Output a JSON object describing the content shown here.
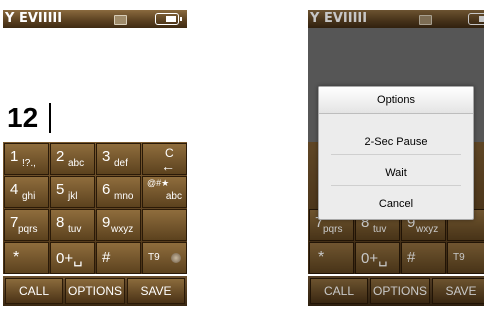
{
  "status": {
    "signal": "Y EV",
    "bars": "IIIII"
  },
  "display": {
    "number": "12"
  },
  "keys": [
    {
      "digit": "1",
      "sub": "!?.,"
    },
    {
      "digit": "2",
      "sub": "abc"
    },
    {
      "digit": "3",
      "sub": "def"
    },
    {
      "digit": "C",
      "sub": "←"
    },
    {
      "digit": "4",
      "sub": "ghi"
    },
    {
      "digit": "5",
      "sub": "jkl"
    },
    {
      "digit": "6",
      "sub": "mno"
    },
    {
      "digit": "@#★",
      "sub": "abc"
    },
    {
      "digit": "7",
      "sub": "pqrs"
    },
    {
      "digit": "8",
      "sub": "tuv"
    },
    {
      "digit": "9",
      "sub": "wxyz"
    },
    {
      "digit": "",
      "sub": ""
    },
    {
      "digit": "*",
      "sub": ""
    },
    {
      "digit": "0+␣",
      "sub": ""
    },
    {
      "digit": "#",
      "sub": ""
    },
    {
      "digit": "T9",
      "sub": ""
    }
  ],
  "softkeys": {
    "call": "CALL",
    "options": "OPTIONS",
    "save": "SAVE"
  },
  "options_menu": {
    "title": "Options",
    "items": [
      "2-Sec Pause",
      "Wait",
      "Cancel"
    ]
  }
}
